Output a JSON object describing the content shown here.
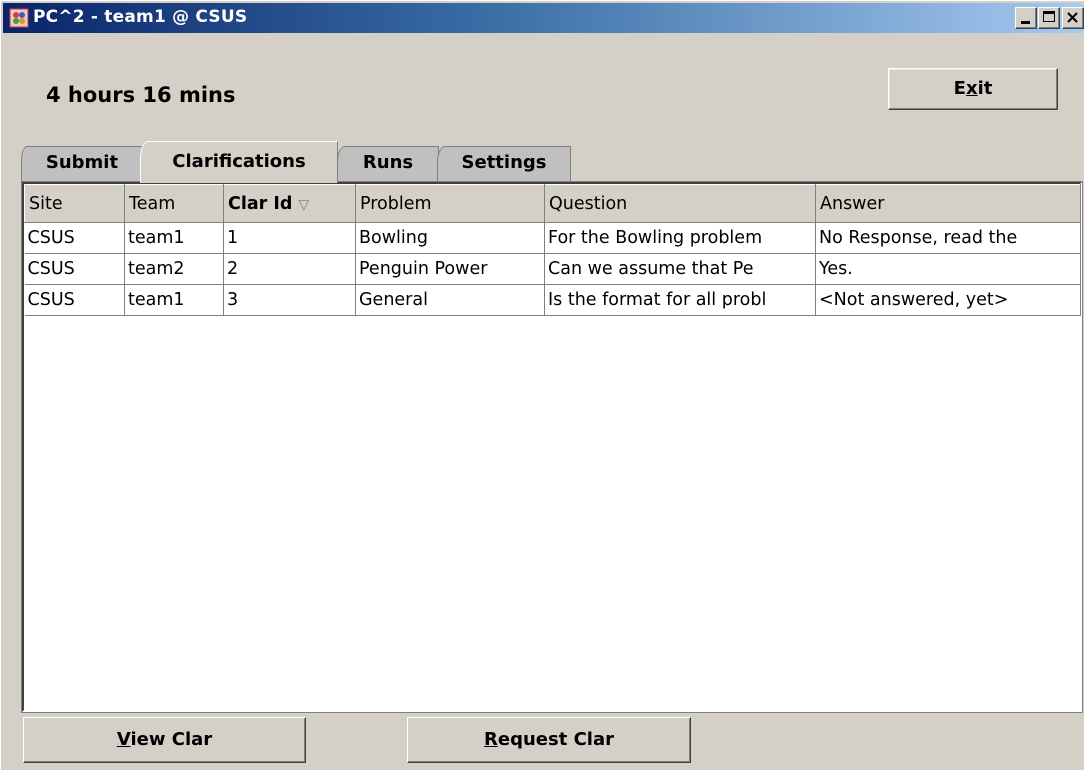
{
  "window": {
    "title": "PC^2 - team1 @ CSUS",
    "controls": {
      "minimize": "minimize",
      "maximize": "maximize",
      "close": "close"
    }
  },
  "header": {
    "timer": "4 hours 16 mins",
    "exit_pre": "E",
    "exit_mn": "x",
    "exit_post": "it"
  },
  "tabs": [
    {
      "label": "Submit"
    },
    {
      "label": "Clarifications",
      "active": true
    },
    {
      "label": "Runs"
    },
    {
      "label": "Settings"
    }
  ],
  "table": {
    "columns": [
      "Site",
      "Team",
      "Clar Id",
      "Problem",
      "Question",
      "Answer"
    ],
    "sorted_column": "Clar Id",
    "sort_indicator": "▽",
    "rows": [
      [
        "CSUS",
        "team1",
        "1",
        "Bowling",
        "For the Bowling problem",
        "No Response, read the"
      ],
      [
        "CSUS",
        "team2",
        "2",
        "Penguin Power",
        "Can we assume that Pe",
        "Yes."
      ],
      [
        "CSUS",
        "team1",
        "3",
        "General",
        "Is the format for all probl",
        "<Not answered, yet>"
      ]
    ]
  },
  "buttons": {
    "view_mn": "V",
    "view_rest": "iew Clar",
    "request_mn": "R",
    "request_rest": "equest Clar"
  },
  "colors": {
    "window_bg": "#d4d0c8",
    "titlebar_start": "#0a246a",
    "titlebar_end": "#a6caf0"
  }
}
